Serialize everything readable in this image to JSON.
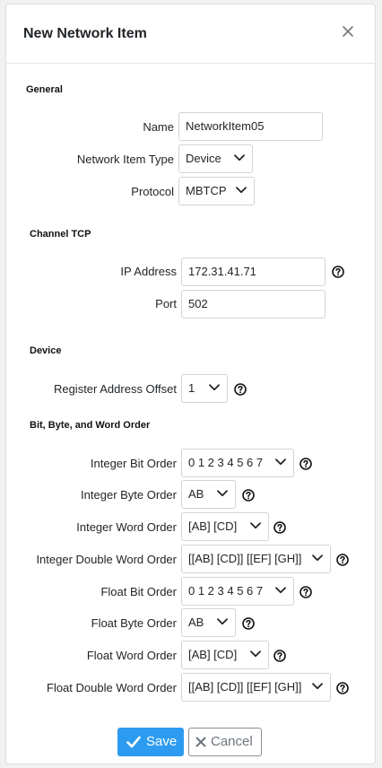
{
  "dialog": {
    "title": "New Network Item",
    "close_icon": "close-icon"
  },
  "sections": {
    "general": "General",
    "channel": "Channel TCP",
    "device": "Device",
    "order": "Bit, Byte, and Word Order"
  },
  "general": {
    "name_label": "Name",
    "name_value": "NetworkItem05",
    "type_label": "Network Item Type",
    "type_value": "Device",
    "protocol_label": "Protocol",
    "protocol_value": "MBTCP"
  },
  "channel": {
    "ip_label": "IP Address",
    "ip_value": "172.31.41.71",
    "port_label": "Port",
    "port_value": "502"
  },
  "device": {
    "offset_label": "Register Address Offset",
    "offset_value": "1"
  },
  "order": {
    "int_bit_label": "Integer Bit Order",
    "int_bit_value": "0 1 2 3 4 5 6 7",
    "int_byte_label": "Integer Byte Order",
    "int_byte_value": "AB",
    "int_word_label": "Integer Word Order",
    "int_word_value": "[AB] [CD]",
    "int_dword_label": "Integer Double Word Order",
    "int_dword_value": "[[AB] [CD]] [[EF] [GH]]",
    "float_bit_label": "Float Bit Order",
    "float_bit_value": "0 1 2 3 4 5 6 7",
    "float_byte_label": "Float Byte Order",
    "float_byte_value": "AB",
    "float_word_label": "Float Word Order",
    "float_word_value": "[AB] [CD]",
    "float_dword_label": "Float Double Word Order",
    "float_dword_value": "[[AB] [CD]] [[EF] [GH]]"
  },
  "footer": {
    "save_label": "Save",
    "cancel_label": "Cancel"
  },
  "colors": {
    "primary": "#2d9cf0",
    "border": "#cfd4da",
    "text": "#212529",
    "muted": "#6c757d"
  }
}
